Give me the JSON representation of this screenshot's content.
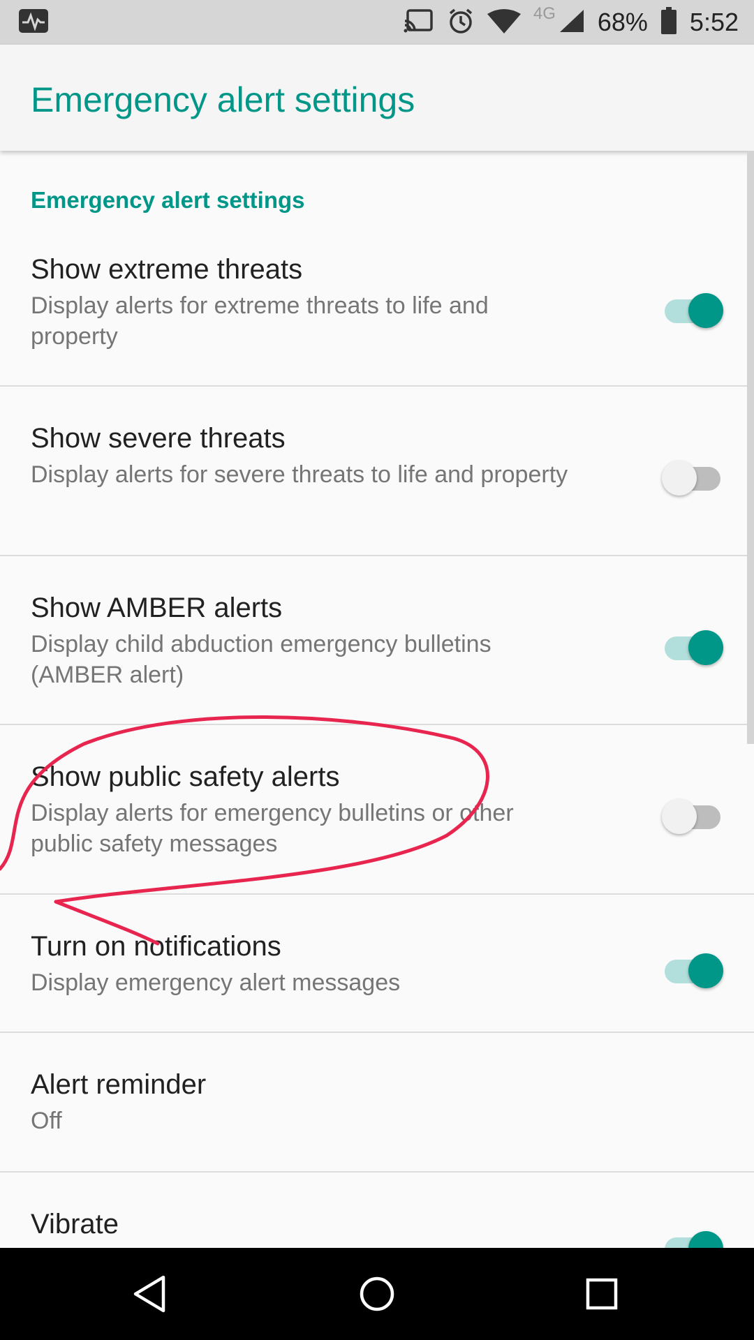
{
  "status_bar": {
    "battery": "68%",
    "time": "5:52",
    "network": "4G",
    "icons": [
      "pulse-icon",
      "cast-icon",
      "alarm-icon",
      "wifi-icon",
      "signal-icon",
      "battery-icon"
    ]
  },
  "app_bar": {
    "title": "Emergency alert settings"
  },
  "section": {
    "header": "Emergency alert settings"
  },
  "prefs": [
    {
      "title": "Show extreme threats",
      "summary": "Display alerts for extreme threats to life and property",
      "switch_on": true
    },
    {
      "title": "Show severe threats",
      "summary": "Display alerts for severe threats to life and property",
      "switch_on": false
    },
    {
      "title": "Show AMBER alerts",
      "summary": "Display child abduction emergency bulletins (AMBER alert)",
      "switch_on": true
    },
    {
      "title": "Show public safety alerts",
      "summary": "Display alerts for emergency bulletins or other public safety messages",
      "switch_on": false
    },
    {
      "title": "Turn on notifications",
      "summary": "Display emergency alert messages",
      "switch_on": true
    },
    {
      "title": "Alert reminder",
      "summary": "Off"
    },
    {
      "title": "Vibrate",
      "switch_on": true
    }
  ],
  "nav_bar": {
    "icons": [
      "back-icon",
      "home-icon",
      "recents-icon"
    ]
  },
  "colors": {
    "accent": "#009688",
    "annotation": "#e8254f"
  }
}
